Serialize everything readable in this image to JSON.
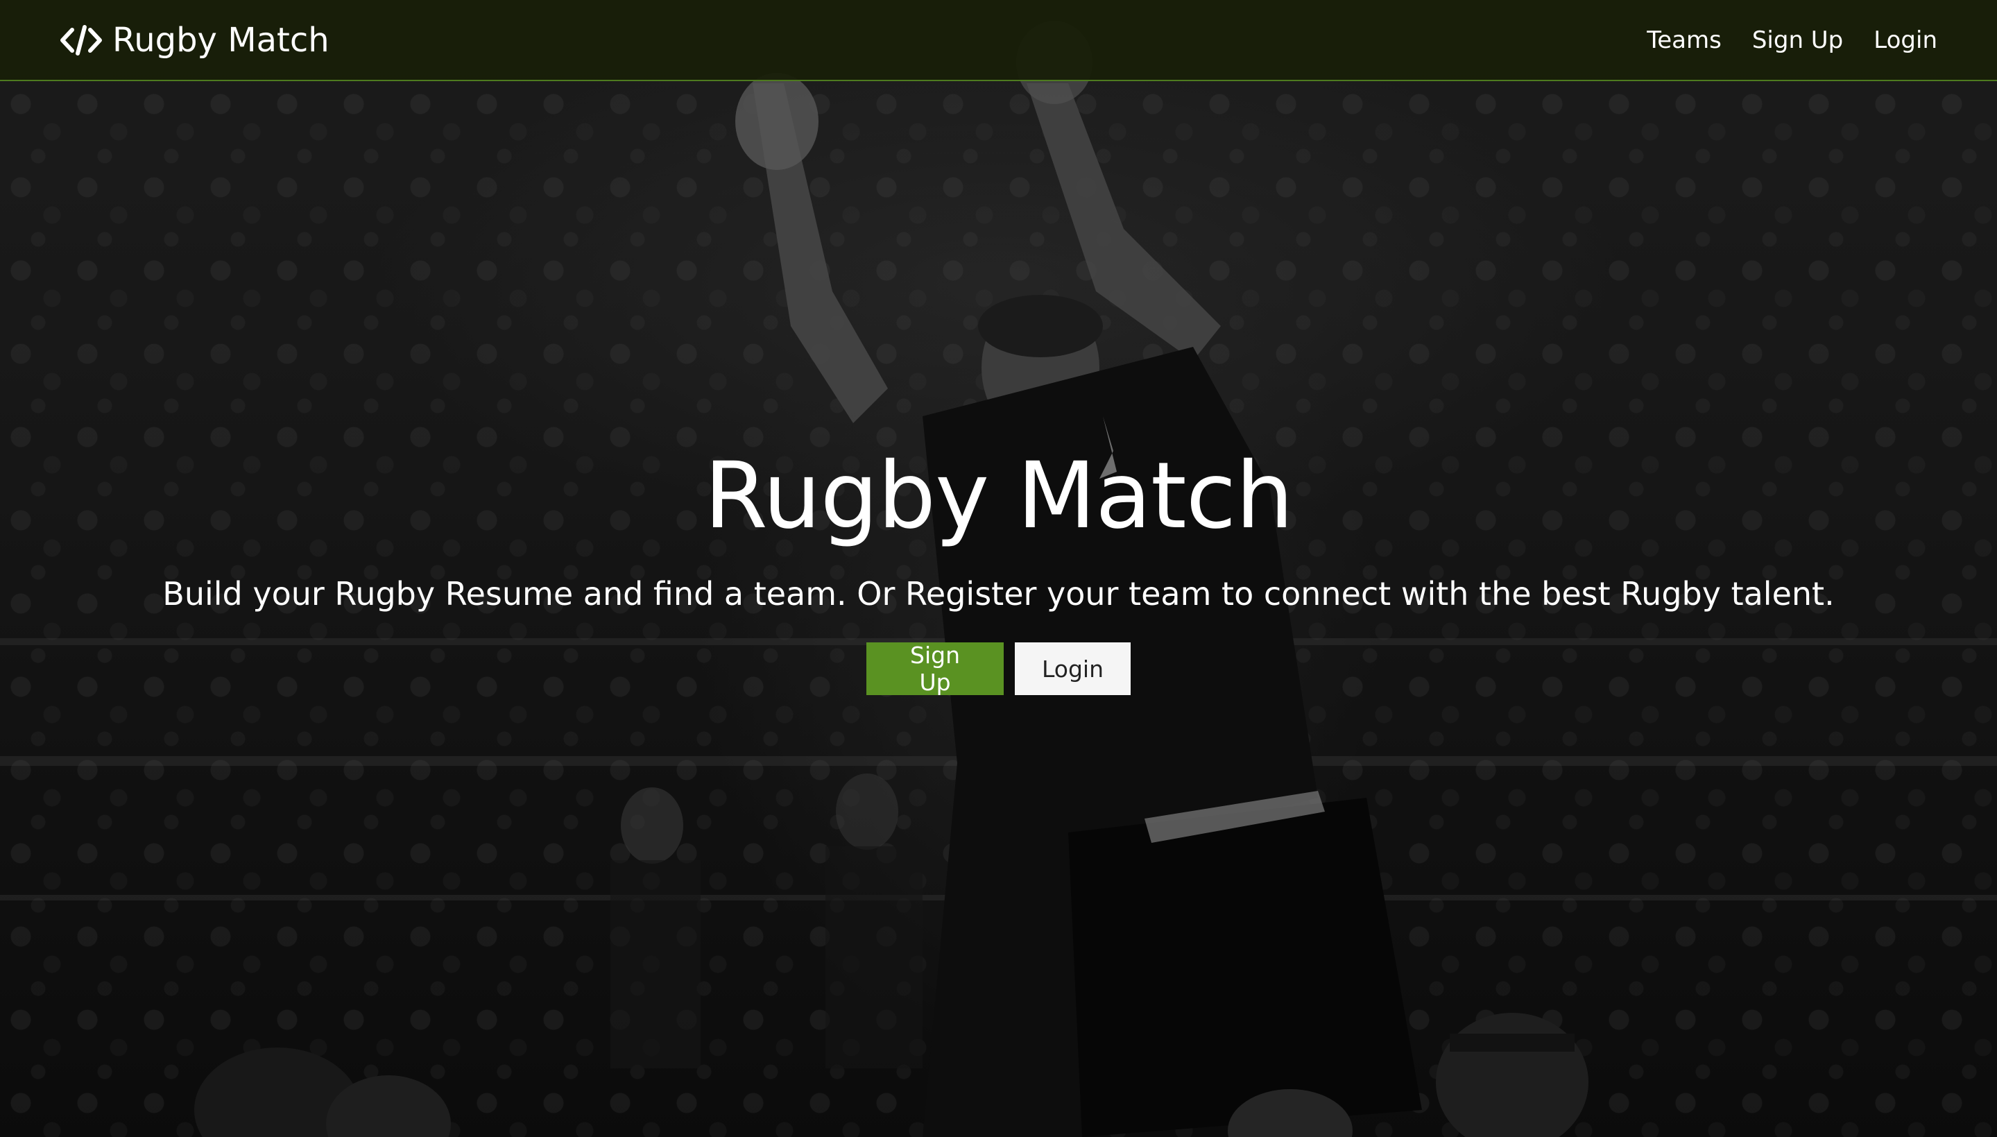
{
  "navbar": {
    "brand": {
      "icon": "code-icon",
      "title": "Rugby Match"
    },
    "links": [
      {
        "label": "Teams"
      },
      {
        "label": "Sign Up"
      },
      {
        "label": "Login"
      }
    ]
  },
  "hero": {
    "title": "Rugby Match",
    "subtitle": "Build your Rugby Resume and find a team. Or Register your team to connect with the best Rugby talent.",
    "buttons": {
      "signup_label": "Sign Up",
      "login_label": "Login"
    }
  },
  "colors": {
    "navbar_bg": "#181e08",
    "navbar_border": "#4e7a1f",
    "primary_button": "#5a9222",
    "light_button": "#f5f5f5",
    "text": "#ffffff"
  }
}
